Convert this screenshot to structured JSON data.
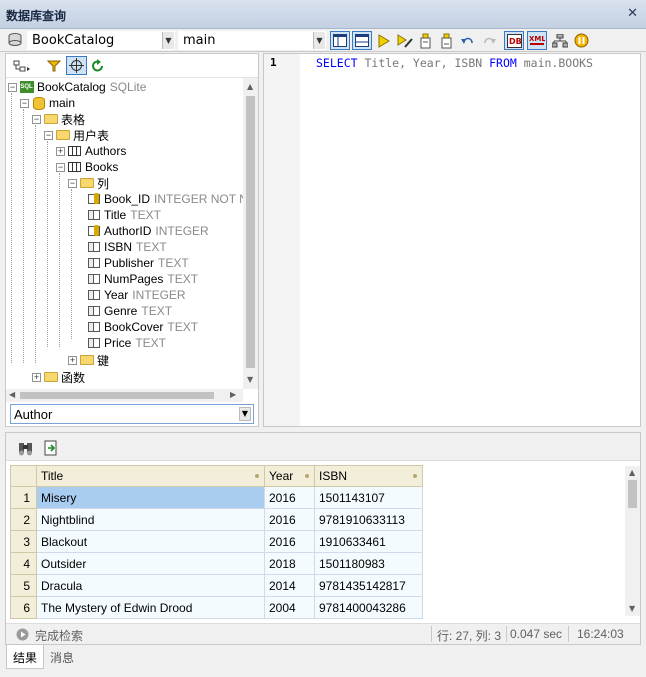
{
  "window": {
    "title": "数据库查询",
    "close_label": "✕"
  },
  "toolbar": {
    "datasource": "BookCatalog",
    "schema": "main"
  },
  "tree": {
    "root": {
      "label": "BookCatalog",
      "type": "SQLite"
    },
    "schema": "main",
    "tables_folder": "表格",
    "user_tables_folder": "用户表",
    "table_authors": "Authors",
    "table_books": "Books",
    "columns_folder": "列",
    "columns": [
      {
        "name": "Book_ID",
        "type": "INTEGER NOT NULL",
        "icon": "primary-key-column-icon"
      },
      {
        "name": "Title",
        "type": "TEXT",
        "icon": "column-icon"
      },
      {
        "name": "AuthorID",
        "type": "INTEGER",
        "icon": "foreign-key-column-icon"
      },
      {
        "name": "ISBN",
        "type": "TEXT",
        "icon": "column-icon"
      },
      {
        "name": "Publisher",
        "type": "TEXT",
        "icon": "column-icon"
      },
      {
        "name": "NumPages",
        "type": "TEXT",
        "icon": "column-icon"
      },
      {
        "name": "Year",
        "type": "INTEGER",
        "icon": "column-icon"
      },
      {
        "name": "Genre",
        "type": "TEXT",
        "icon": "column-icon"
      },
      {
        "name": "BookCover",
        "type": "TEXT",
        "icon": "column-icon"
      },
      {
        "name": "Price",
        "type": "TEXT",
        "icon": "column-icon"
      }
    ],
    "keys_folder": "键",
    "functions_folder": "函数",
    "filter_value": "Author"
  },
  "editor": {
    "line_number": "1",
    "sql": {
      "kw_select": "SELECT",
      "fields": " Title, Year, ISBN ",
      "kw_from": "FROM",
      "table": " main.BOOKS"
    }
  },
  "results": {
    "columns": [
      "Title",
      "Year",
      "ISBN"
    ],
    "rows": [
      {
        "n": "1",
        "title": "Misery",
        "year": "2016",
        "isbn": "1501143107"
      },
      {
        "n": "2",
        "title": "Nightblind",
        "year": "2016",
        "isbn": "9781910633113"
      },
      {
        "n": "3",
        "title": "Blackout",
        "year": "2016",
        "isbn": "1910633461"
      },
      {
        "n": "4",
        "title": "Outsider",
        "year": "2018",
        "isbn": "1501180983"
      },
      {
        "n": "5",
        "title": "Dracula",
        "year": "2014",
        "isbn": "9781435142817"
      },
      {
        "n": "6",
        "title": "The Mystery of Edwin Drood",
        "year": "2004",
        "isbn": "9781400043286"
      }
    ],
    "selected_row": 1
  },
  "status": {
    "message": "完成检索",
    "position": "行: 27, 列: 3",
    "elapsed": "0.047 sec",
    "time": "16:24:03"
  },
  "tabs": {
    "results": "结果",
    "messages": "消息"
  }
}
